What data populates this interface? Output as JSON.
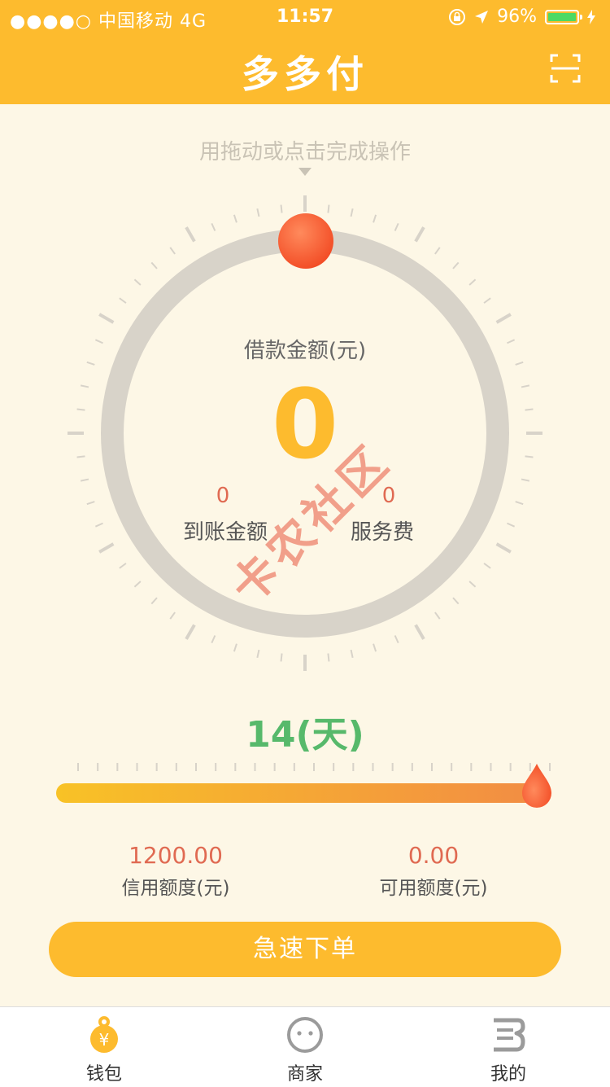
{
  "status_bar": {
    "carrier": "●●●●○ 中国移动  4G",
    "time": "11:57",
    "battery": "96%"
  },
  "nav": {
    "title": "多多付",
    "scan_icon": "scan-icon"
  },
  "hint": "用拖动或点击完成操作",
  "dial": {
    "label": "借款金额(元)",
    "amount": "0",
    "received_value": "0",
    "received_label": "到账金额",
    "fee_value": "0",
    "fee_label": "服务费"
  },
  "watermark": "卡农社区",
  "term": {
    "days_label": "14(天)",
    "slider_fraction": 1.0
  },
  "credit": {
    "limit_value": "1200.00",
    "limit_label": "信用额度(元)",
    "available_value": "0.00",
    "available_label": "可用额度(元)"
  },
  "order_button": "急速下单",
  "tabs": [
    {
      "label": "钱包",
      "icon": "wallet-icon",
      "active": true
    },
    {
      "label": "商家",
      "icon": "merchant-icon",
      "active": false
    },
    {
      "label": "我的",
      "icon": "profile-icon",
      "active": false
    }
  ],
  "colors": {
    "brand": "#fdbb2e",
    "accent_red": "#e06a52",
    "green": "#57b96b",
    "background": "#fdf7e6"
  }
}
